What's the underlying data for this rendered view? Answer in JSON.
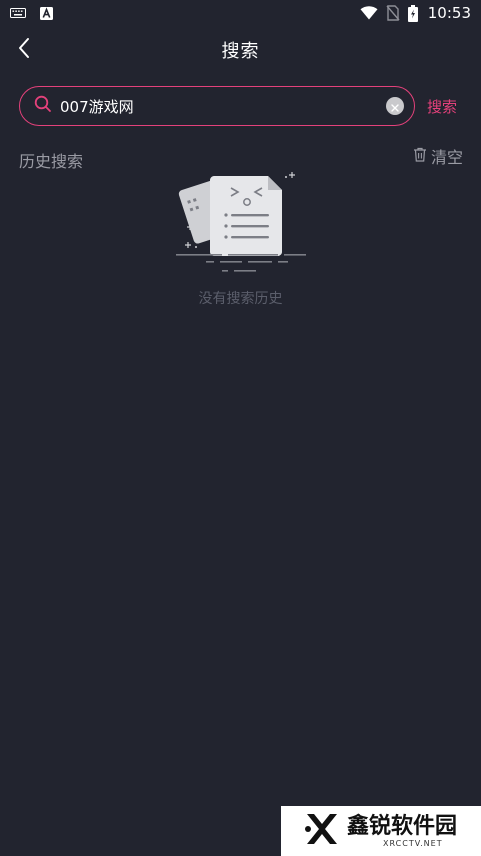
{
  "status_bar": {
    "time": "10:53",
    "left_icons": [
      "keyboard-icon",
      "font-a-icon"
    ],
    "right_icons": [
      "wifi-icon",
      "no-sim-icon",
      "battery-charging-icon"
    ]
  },
  "header": {
    "title": "搜索",
    "back_icon": "chevron-left-icon"
  },
  "search": {
    "value": "007游戏网",
    "button_label": "搜索",
    "accent_color": "#e4417b"
  },
  "history": {
    "title": "历史搜索",
    "clear_label": "清空",
    "empty_text": "没有搜索历史"
  },
  "watermark": {
    "title": "鑫锐软件园",
    "subtitle": "XRCCTV.NET"
  },
  "colors": {
    "background": "#22242f",
    "muted_text": "#9a9ba4",
    "empty_text": "#5b5e6b"
  }
}
